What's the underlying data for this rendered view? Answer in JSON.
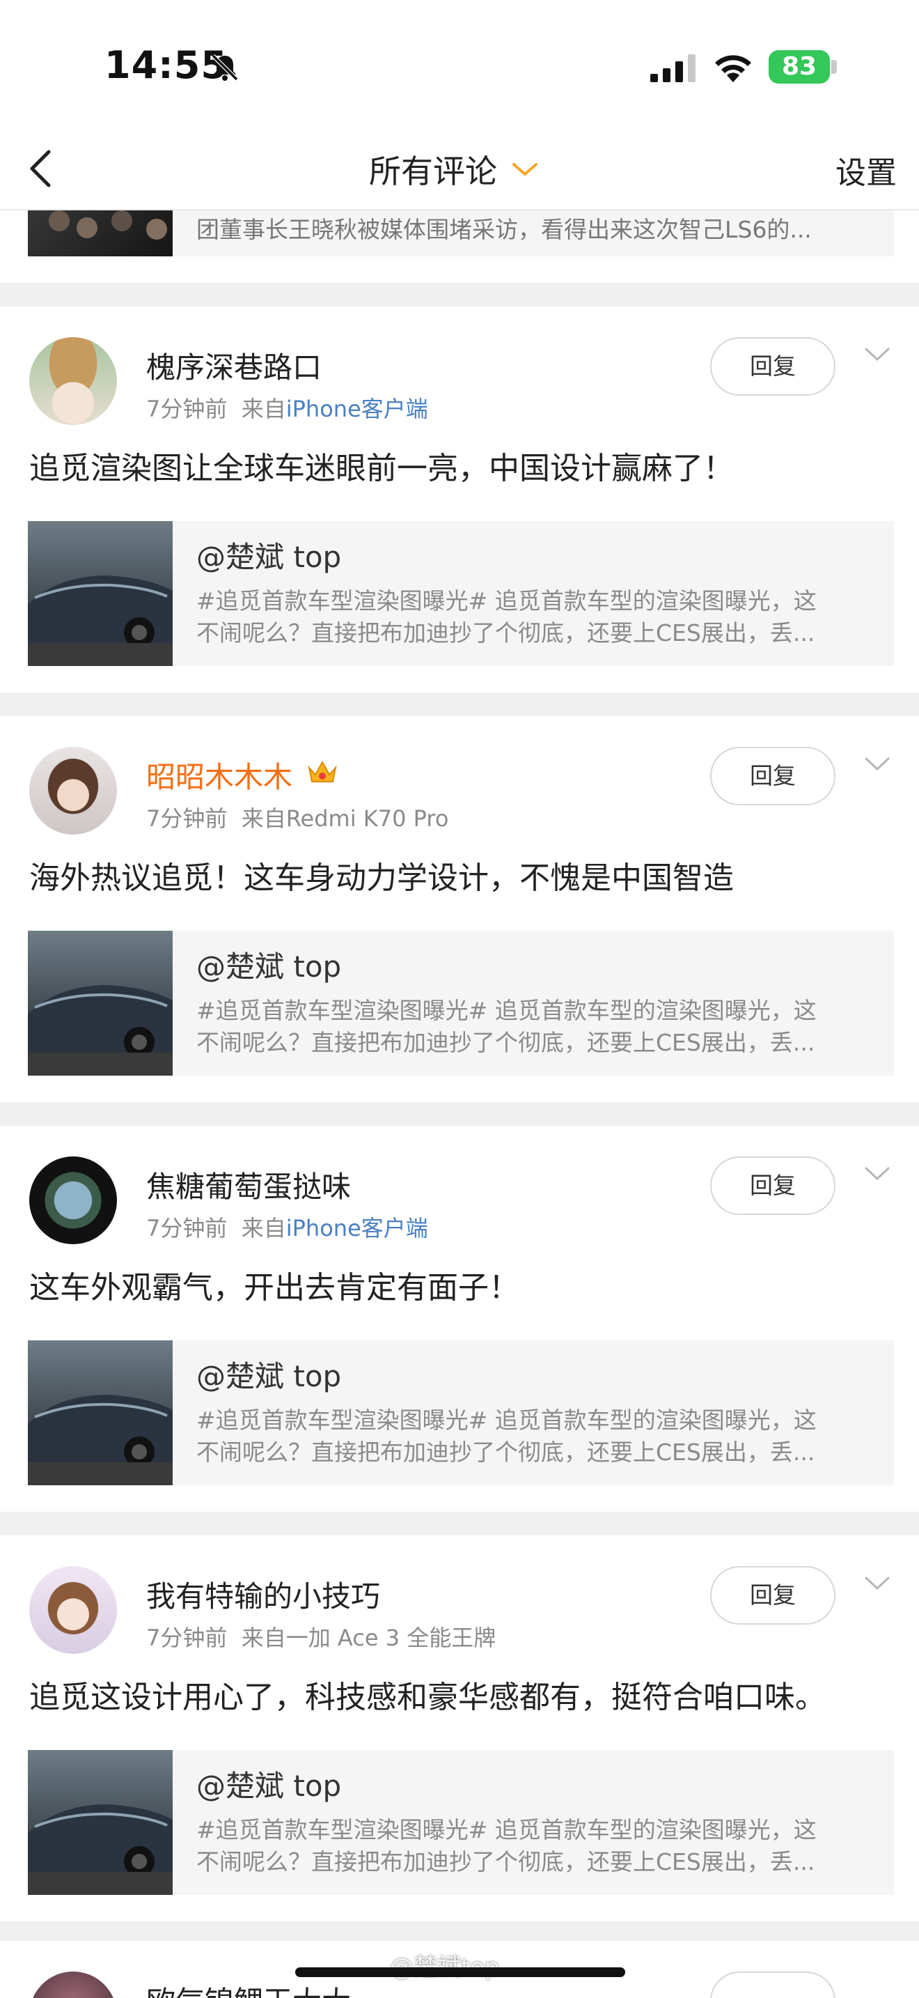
{
  "status_bar": {
    "time": "14:55",
    "battery": "83"
  },
  "nav": {
    "title": "所有评论",
    "settings": "设置"
  },
  "partial_post_text": "团董事长王晓秋被媒体围堵采访，看得出来这次智己LS6的...",
  "comments": [
    {
      "username": "槐序深巷路口",
      "time": "7分钟前",
      "from": "来自",
      "source": "iPhone客户端",
      "text": "追觅渲染图让全球车迷眼前一亮，中国设计赢麻了！",
      "reply": "回复",
      "quote": {
        "author": "@楚斌 top",
        "line1": "#追觅首款车型渲染图曝光#  追觅首款车型的渲染图曝光，这",
        "line2": "不闹呢么？直接把布加迪抄了个彻底，还要上CES展出，丢..."
      }
    },
    {
      "username": "昭昭木木木",
      "time": "7分钟前",
      "from": "来自",
      "source": "Redmi K70 Pro",
      "text": "海外热议追觅！这车身动力学设计，不愧是中国智造",
      "reply": "回复",
      "quote": {
        "author": "@楚斌 top",
        "line1": "#追觅首款车型渲染图曝光#  追觅首款车型的渲染图曝光，这",
        "line2": "不闹呢么？直接把布加迪抄了个彻底，还要上CES展出，丢..."
      }
    },
    {
      "username": "焦糖葡萄蛋挞味",
      "time": "7分钟前",
      "from": "来自",
      "source": "iPhone客户端",
      "text": "这车外观霸气，开出去肯定有面子！",
      "reply": "回复",
      "quote": {
        "author": "@楚斌 top",
        "line1": "#追觅首款车型渲染图曝光#  追觅首款车型的渲染图曝光，这",
        "line2": "不闹呢么？直接把布加迪抄了个彻底，还要上CES展出，丢..."
      }
    },
    {
      "username": "我有特输的小技巧",
      "time": "7分钟前",
      "from": "来自",
      "source": "一加 Ace 3 全能王牌",
      "text": "追觅这设计用心了，科技感和豪华感都有，挺符合咱口味。",
      "reply": "回复",
      "quote": {
        "author": "@楚斌 top",
        "line1": "#追觅首款车型渲染图曝光#  追觅首款车型的渲染图曝光，这",
        "line2": "不闹呢么？直接把布加迪抄了个彻底，还要上CES展出，丢..."
      }
    }
  ],
  "bottom_partial": {
    "username": "欧气锦鲤王大大"
  },
  "watermark": "@楚斌top",
  "colors": {
    "accent_orange": "#f5a623",
    "vip_name": "#f56d13",
    "link_blue": "#4a80c2",
    "battery_green": "#34c759"
  }
}
